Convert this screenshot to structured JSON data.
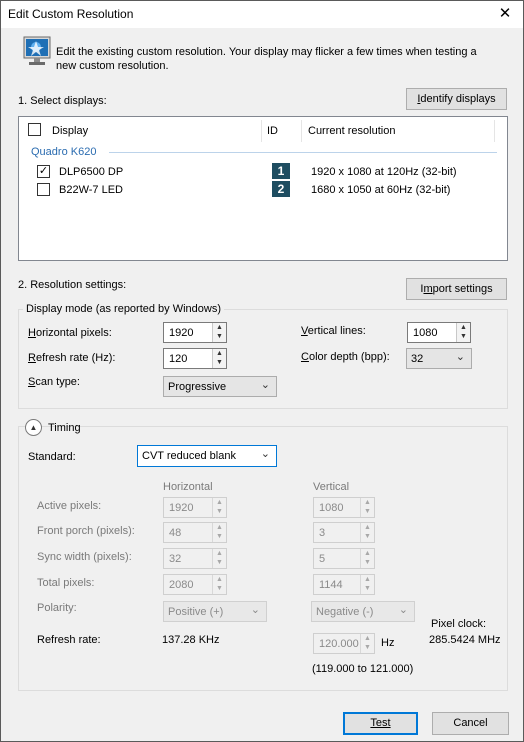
{
  "window": {
    "title": "Edit Custom Resolution",
    "close_glyph": "✕"
  },
  "intro": {
    "line1": "Edit the existing custom resolution. Your display may flicker a few times when testing a",
    "line2": "new custom resolution.",
    "icon": "monitor-icon"
  },
  "select_displays": {
    "heading": "1. Select displays:",
    "identify_button": {
      "u": "I",
      "rest": "dentify displays"
    },
    "columns": {
      "display": "Display",
      "id": "ID",
      "resolution": "Current resolution"
    },
    "gpu_group": "Quadro K620",
    "rows": [
      {
        "checked": true,
        "check_mark": "✓",
        "name": "DLP6500 DP",
        "id": "1",
        "resolution": "1920 x 1080 at 120Hz (32-bit)"
      },
      {
        "checked": false,
        "check_mark": "",
        "name": "B22W-7 LED",
        "id": "2",
        "resolution": "1680 x 1050 at 60Hz (32-bit)"
      }
    ]
  },
  "resolution_settings": {
    "heading": "2. Resolution settings:",
    "import_button": {
      "pre": "I",
      "u": "m",
      "rest": "port settings"
    },
    "display_mode_legend": "Display mode (as reported by Windows)",
    "horizontal_pixels": {
      "u": "H",
      "rest": "orizontal pixels:",
      "value": "1920"
    },
    "vertical_lines": {
      "u": "V",
      "rest": "ertical lines:",
      "value": "1080"
    },
    "refresh_rate": {
      "u": "R",
      "rest": "efresh rate (Hz):",
      "value": "120"
    },
    "color_depth": {
      "u": "C",
      "rest": "olor depth (bpp):",
      "value": "32"
    },
    "scan_type": {
      "u": "S",
      "rest": "can type:",
      "value": "Progressive"
    }
  },
  "timing": {
    "toggle_glyph": "▲",
    "label": "Timing",
    "standard": {
      "label": "Standard:",
      "value": "CVT reduced blank"
    },
    "col_horizontal": "Horizontal",
    "col_vertical": "Vertical",
    "rows": [
      {
        "label": "Active pixels:",
        "h": "1920",
        "v": "1080"
      },
      {
        "label": "Front porch (pixels):",
        "h": "48",
        "v": "3"
      },
      {
        "label": "Sync width (pixels):",
        "h": "32",
        "v": "5"
      },
      {
        "label": "Total pixels:",
        "h": "2080",
        "v": "1144"
      }
    ],
    "polarity": {
      "label": "Polarity:",
      "h": "Positive (+)",
      "v": "Negative (-)"
    },
    "refresh": {
      "label": "Refresh rate:",
      "h": "137.28 KHz",
      "v": "120.000",
      "unit": "Hz",
      "range": "(119.000 to 121.000)"
    },
    "pixel_clock": {
      "label": "Pixel clock:",
      "value": "285.5424 MHz"
    }
  },
  "footer": {
    "test": "Test",
    "cancel": "Cancel"
  },
  "spin_up": "▲",
  "spin_down": "▼",
  "dd_caret": "⌄",
  "colors": {
    "accent": "#0078d7",
    "id_badge": "#1e4d61",
    "group_label": "#2b6cb0"
  }
}
